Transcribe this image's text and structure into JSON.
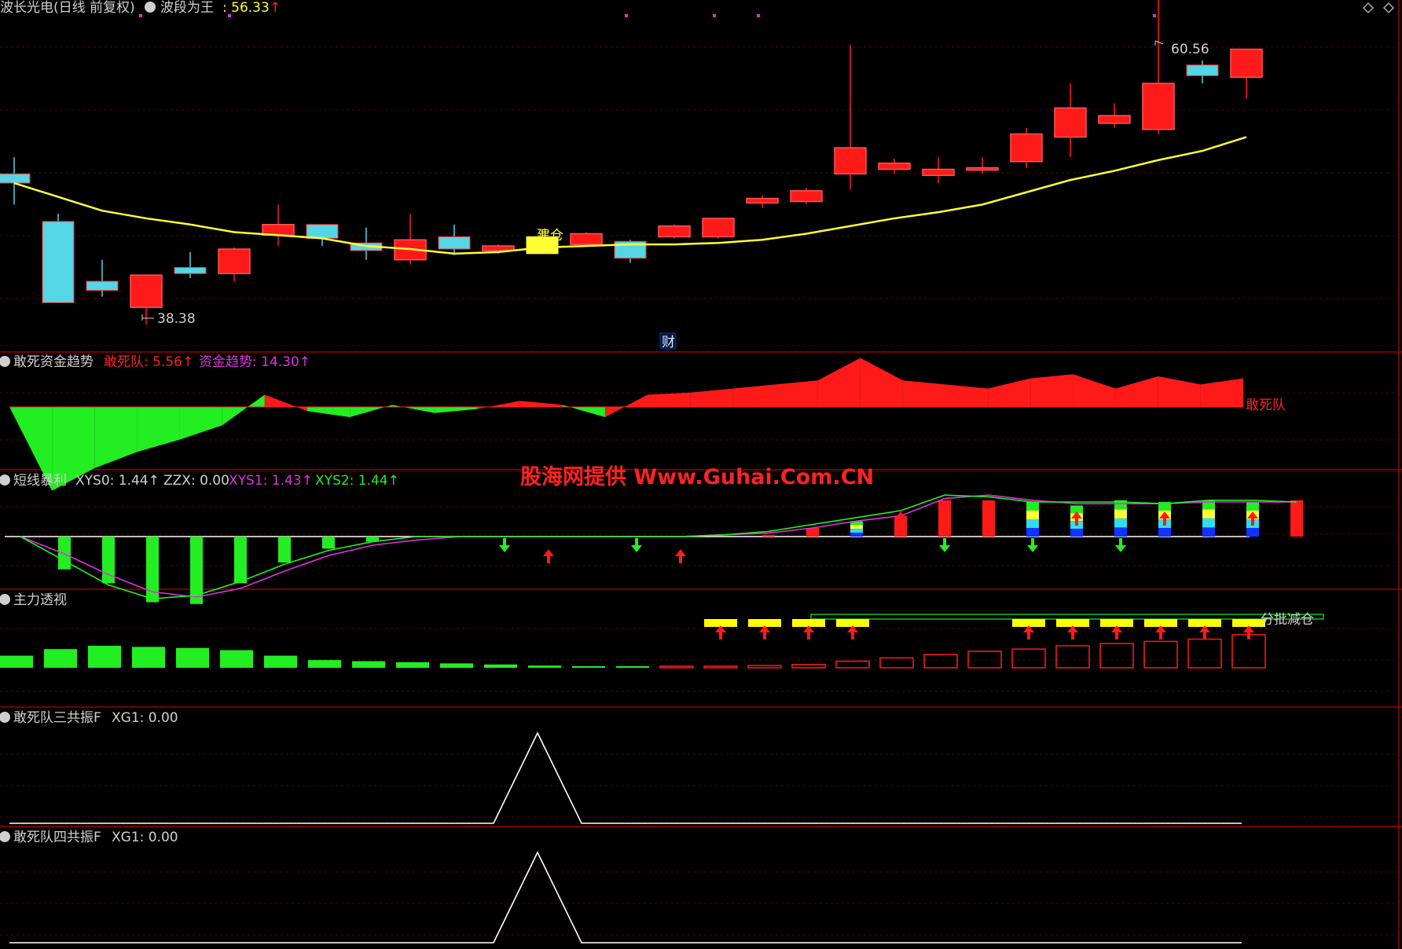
{
  "colors": {
    "bg": "#000000",
    "up": "#ff1a1a",
    "down": "#54d6e6",
    "ma": "#ffff33",
    "green": "#22ee22",
    "magenta": "#dd33dd",
    "yellow": "#ffff00",
    "white": "#ffffff",
    "label": "#d0d0d0"
  },
  "header": {
    "title": "波长光电(日线 前复权)",
    "indicator_name": "波段为王",
    "indicator_value": ": 56.33",
    "up_arrow": "↑"
  },
  "main_chart": {
    "high_label": "60.56",
    "low_label": "38.38",
    "signal_label": "建仓",
    "fin_badge": "财"
  },
  "panel1": {
    "title": "敢死资金趋势",
    "legend": [
      {
        "text": "敢死队: 5.56↑",
        "color": "#ff2020"
      },
      {
        "text": "资金趋势: 14.30↑",
        "color": "#dd33dd"
      }
    ],
    "series_label": "敢死队"
  },
  "panel2": {
    "title": "短线暴利",
    "legend": [
      {
        "text": "XYS0: 1.44↑",
        "color": "#d0d0d0"
      },
      {
        "text": "ZZX: 0.00",
        "color": "#d0d0d0"
      },
      {
        "text": "XYS1: 1.43↑",
        "color": "#dd33dd"
      },
      {
        "text": "XYS2: 1.44↑",
        "color": "#22ee22"
      }
    ]
  },
  "panel3": {
    "title": "主力透视",
    "signal_label": "分批减仓"
  },
  "panel4": {
    "title": "敢死队三共振F",
    "legend": "XG1: 0.00"
  },
  "panel5": {
    "title": "敢死队四共振F",
    "legend": "XG1: 0.00"
  },
  "watermark": "股海网提供 Www.Guhai.Com.CN",
  "chart_data": {
    "type": "candlestick",
    "candles": [
      {
        "o": 48.2,
        "c": 47.6,
        "h": 49.3,
        "l": 46.2
      },
      {
        "o": 45.1,
        "c": 39.8,
        "h": 45.6,
        "l": 39.8
      },
      {
        "o": 41.2,
        "c": 40.6,
        "h": 42.6,
        "l": 40.2
      },
      {
        "o": 39.5,
        "c": 41.6,
        "h": 41.6,
        "l": 38.38
      },
      {
        "o": 42.1,
        "c": 41.7,
        "h": 43.1,
        "l": 41.4
      },
      {
        "o": 41.7,
        "c": 43.3,
        "h": 43.4,
        "l": 41.2
      },
      {
        "o": 44.2,
        "c": 44.9,
        "h": 46.2,
        "l": 43.5
      },
      {
        "o": 44.9,
        "c": 44.0,
        "h": 44.9,
        "l": 43.5
      },
      {
        "o": 43.7,
        "c": 43.2,
        "h": 44.7,
        "l": 42.6
      },
      {
        "o": 42.6,
        "c": 43.9,
        "h": 45.6,
        "l": 42.3
      },
      {
        "o": 44.1,
        "c": 43.3,
        "h": 44.9,
        "l": 42.9
      },
      {
        "o": 43.2,
        "c": 43.5,
        "h": 43.6,
        "l": 43.0
      },
      {
        "o": 44.1,
        "c": 43.0,
        "h": 44.6,
        "l": 43.0
      },
      {
        "o": 43.6,
        "c": 44.3,
        "h": 44.4,
        "l": 43.7
      },
      {
        "o": 43.8,
        "c": 42.7,
        "h": 43.9,
        "l": 42.4
      },
      {
        "o": 44.1,
        "c": 44.8,
        "h": 44.9,
        "l": 44.0
      },
      {
        "o": 44.1,
        "c": 45.3,
        "h": 45.3,
        "l": 44.0
      },
      {
        "o": 46.3,
        "c": 46.6,
        "h": 46.8,
        "l": 46.0
      },
      {
        "o": 46.4,
        "c": 47.1,
        "h": 47.3,
        "l": 46.2
      },
      {
        "o": 48.2,
        "c": 49.9,
        "h": 56.6,
        "l": 47.2
      },
      {
        "o": 48.5,
        "c": 48.9,
        "h": 49.2,
        "l": 48.2
      },
      {
        "o": 48.1,
        "c": 48.5,
        "h": 49.3,
        "l": 47.6
      },
      {
        "o": 48.5,
        "c": 48.6,
        "h": 49.3,
        "l": 48.2
      },
      {
        "o": 49.0,
        "c": 50.8,
        "h": 51.2,
        "l": 48.6
      },
      {
        "o": 50.6,
        "c": 52.5,
        "h": 54.1,
        "l": 49.3
      },
      {
        "o": 51.5,
        "c": 52.0,
        "h": 52.8,
        "l": 51.2
      },
      {
        "o": 51.1,
        "c": 54.1,
        "h": 60.56,
        "l": 50.8
      },
      {
        "o": 55.3,
        "c": 54.6,
        "h": 55.6,
        "l": 54.1
      },
      {
        "o": 54.5,
        "c": 56.33,
        "h": 56.33,
        "l": 53.1
      }
    ],
    "ma": [
      47.6,
      46.7,
      45.8,
      45.3,
      44.9,
      44.4,
      44.2,
      44.0,
      43.5,
      43.3,
      43.0,
      43.1,
      43.4,
      43.5,
      43.6,
      43.6,
      43.7,
      43.9,
      44.3,
      44.8,
      45.3,
      45.7,
      46.2,
      47.0,
      47.8,
      48.4,
      49.1,
      49.7,
      50.6
    ],
    "price_range": [
      37,
      58
    ],
    "gansi": [
      0,
      -4.1,
      -3.0,
      -2.2,
      -1.6,
      -0.9,
      0.6,
      -0.2,
      -0.5,
      0.1,
      -0.3,
      -0.1,
      0.3,
      0.1,
      -0.5,
      0.6,
      0.7,
      0.9,
      1.1,
      1.3,
      2.4,
      1.3,
      1.1,
      0.9,
      1.4,
      1.6,
      0.9,
      1.5,
      1.1,
      1.4
    ],
    "xys_bars": [
      0,
      -0.95,
      -1.35,
      -1.9,
      -1.95,
      -1.35,
      -0.75,
      -0.35,
      -0.15,
      0,
      0,
      0,
      0,
      0,
      0,
      0,
      0,
      0.05,
      0.25,
      0.45,
      0.6,
      1.05,
      1.05,
      1.0,
      0.9,
      1.05,
      1.0,
      1.05,
      1.0,
      1.05
    ],
    "xys1": [
      0,
      -0.5,
      -1.1,
      -1.6,
      -1.75,
      -1.5,
      -1.0,
      -0.55,
      -0.25,
      -0.1,
      0,
      0,
      0,
      0,
      0,
      0,
      0.05,
      0.1,
      0.25,
      0.45,
      0.6,
      1.1,
      1.2,
      1.05,
      0.95,
      0.95,
      0.95,
      1.0,
      1.0,
      1.0
    ],
    "xys2": [
      0,
      -0.7,
      -1.4,
      -1.8,
      -1.7,
      -1.3,
      -0.8,
      -0.4,
      -0.15,
      0,
      0,
      0,
      0,
      0,
      0,
      0,
      0.05,
      0.15,
      0.35,
      0.55,
      0.75,
      1.2,
      1.15,
      1.0,
      1.0,
      1.0,
      0.95,
      1.05,
      1.05,
      1.0
    ],
    "xys_range": [
      -2.2,
      1.5
    ],
    "zhuli": [
      -0.55,
      -0.85,
      -1.0,
      -0.95,
      -0.9,
      -0.8,
      -0.55,
      -0.35,
      -0.3,
      -0.25,
      -0.2,
      -0.15,
      -0.1,
      -0.05,
      -0.02,
      0.02,
      0.05,
      0.1,
      0.15,
      0.3,
      0.45,
      0.6,
      0.75,
      0.85,
      1.0,
      1.1,
      1.2,
      1.3,
      1.5
    ],
    "resonance3": [
      0,
      0,
      0,
      0,
      0,
      0,
      0,
      0,
      0,
      0,
      0,
      0,
      1,
      0,
      0,
      0,
      0,
      0,
      0,
      0,
      0,
      0,
      0,
      0,
      0,
      0,
      0,
      0,
      0
    ],
    "resonance4": [
      0,
      0,
      0,
      0,
      0,
      0,
      0,
      0,
      0,
      0,
      0,
      0,
      1,
      0,
      0,
      0,
      0,
      0,
      0,
      0,
      0,
      0,
      0,
      0,
      0,
      0,
      0,
      0,
      0
    ],
    "jiancang_index": 12,
    "reduce_indices": [
      16,
      17,
      18,
      19,
      23,
      24,
      25,
      26,
      27,
      28
    ],
    "green_arrow_idx": [
      11,
      14,
      21,
      23,
      25
    ],
    "red_arrow_idx": [
      12,
      15,
      20,
      22,
      24,
      26,
      28
    ],
    "tri_bar_idx": [
      19,
      23,
      24,
      25,
      26,
      27,
      28
    ]
  }
}
